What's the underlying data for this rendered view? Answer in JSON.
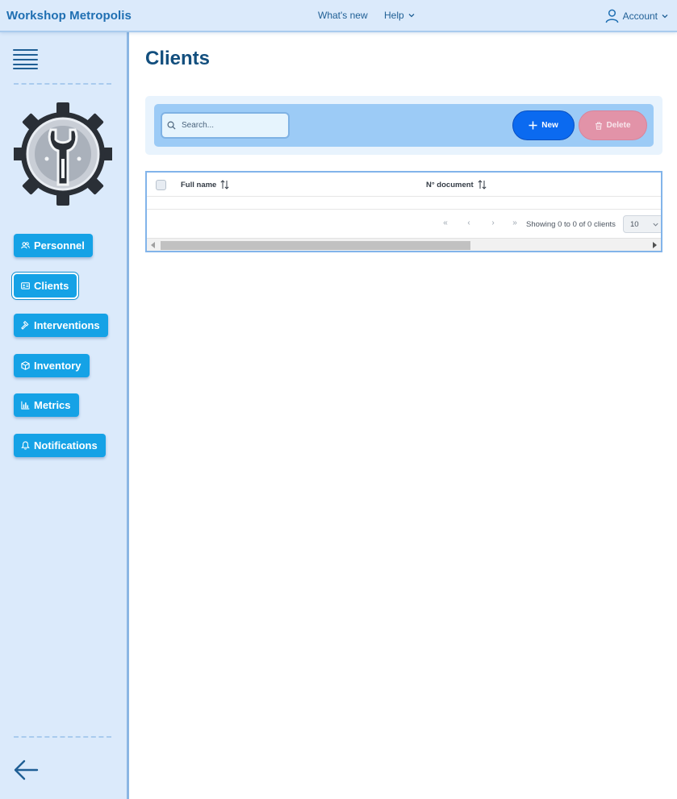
{
  "header": {
    "brand": "Workshop Metropolis",
    "whats_new": "What's new",
    "help": "Help",
    "account": "Account"
  },
  "sidebar": {
    "items": [
      {
        "label": "Personnel",
        "icon": "users-icon"
      },
      {
        "label": "Clients",
        "icon": "id-card-icon",
        "active": true
      },
      {
        "label": "Interventions",
        "icon": "hammer-icon"
      },
      {
        "label": "Inventory",
        "icon": "box-icon"
      },
      {
        "label": "Metrics",
        "icon": "bar-chart-icon"
      },
      {
        "label": "Notifications",
        "icon": "bell-icon"
      }
    ]
  },
  "main": {
    "title": "Clients",
    "search_placeholder": "Search...",
    "new_label": "New",
    "delete_label": "Delete",
    "table": {
      "columns": [
        "Full name",
        "N° document"
      ],
      "rows": [],
      "pagination_info": "Showing 0 to 0 of 0 clients",
      "page_size": "10"
    }
  },
  "colors": {
    "accent": "#15a2e6",
    "primary_button": "#0b6af0",
    "delete_button": "#e293a8",
    "title": "#134f7e"
  }
}
